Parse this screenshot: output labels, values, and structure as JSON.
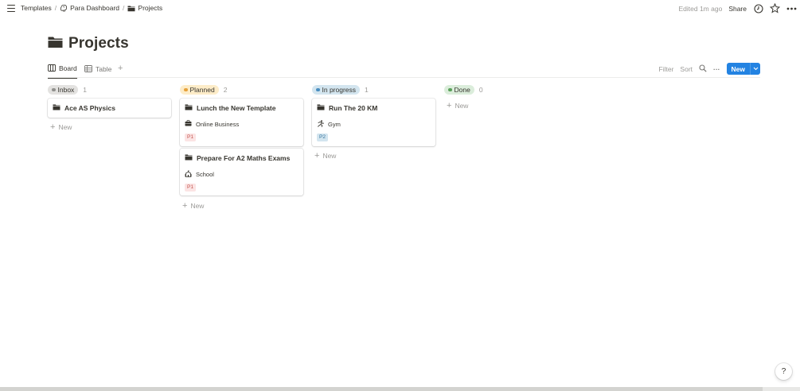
{
  "breadcrumb": [
    {
      "label": "Templates",
      "icon": "none"
    },
    {
      "label": "Para Dashboard",
      "icon": "brain-icon"
    },
    {
      "label": "Projects",
      "icon": "folder-icon"
    }
  ],
  "topbar": {
    "edited": "Edited 1m ago",
    "share": "Share"
  },
  "page": {
    "title": "Projects",
    "icon": "folder-icon"
  },
  "views": {
    "board": "Board",
    "table": "Table",
    "add": "+",
    "filter": "Filter",
    "sort": "Sort",
    "more": "···",
    "new": "New"
  },
  "colors": {
    "accent": "#2383e2",
    "inbox_bg": "#e3e2e0",
    "inbox_dot": "#91918e",
    "planned_bg": "#fdecc8",
    "planned_dot": "#e6a13b",
    "inprogress_bg": "#d3e5ef",
    "inprogress_dot": "#4a8ec0",
    "done_bg": "#dbeddb",
    "done_dot": "#5aa05a"
  },
  "columns": [
    {
      "name": "Inbox",
      "count": "1",
      "cards": [
        {
          "title": "Ace AS Physics"
        }
      ],
      "add_label": "New"
    },
    {
      "name": "Planned",
      "count": "2",
      "cards": [
        {
          "title": "Lunch the New Template",
          "area": "Online Business",
          "area_icon": "briefcase-icon",
          "priority": "P1"
        },
        {
          "title": "Prepare For A2 Maths Exams",
          "area": "School",
          "area_icon": "school-icon",
          "priority": "P1"
        }
      ],
      "add_label": "New"
    },
    {
      "name": "In progress",
      "count": "1",
      "cards": [
        {
          "title": "Run The 20 KM",
          "area": "Gym",
          "area_icon": "running-icon",
          "priority": "P2"
        }
      ],
      "add_label": "New"
    },
    {
      "name": "Done",
      "count": "0",
      "cards": [],
      "add_label": "New"
    }
  ],
  "help": "?"
}
